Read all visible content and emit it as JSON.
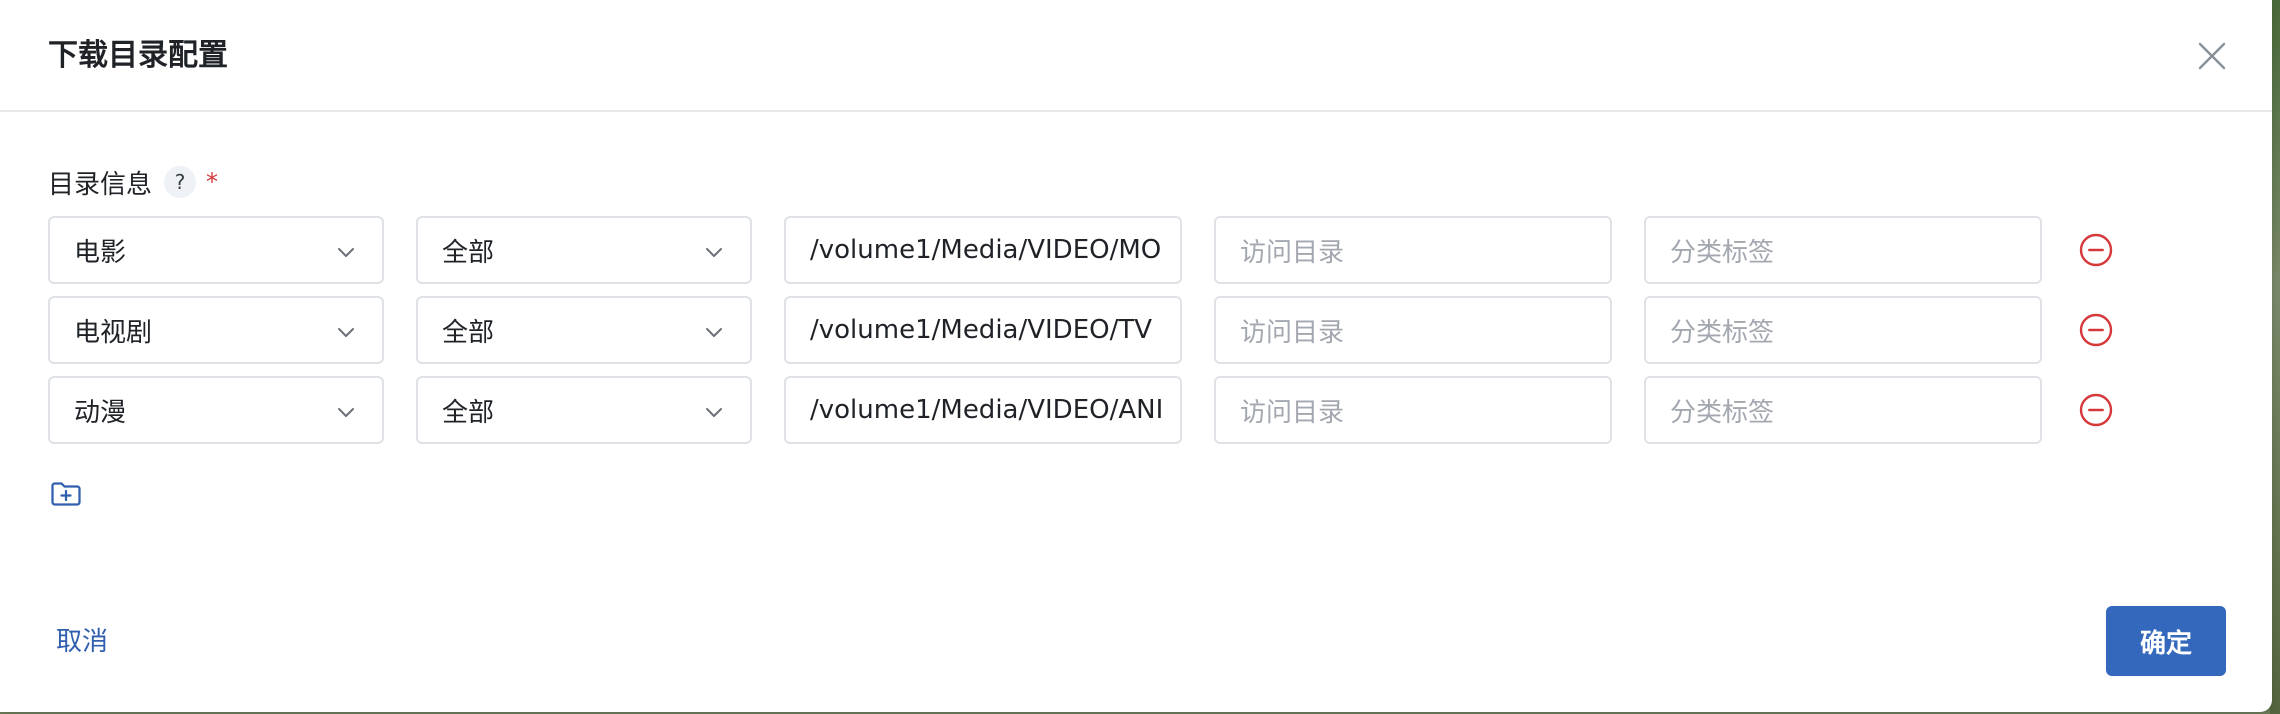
{
  "dialog": {
    "title": "下载目录配置",
    "cancel_label": "取消",
    "confirm_label": "确定"
  },
  "field": {
    "label": "目录信息",
    "help": "?",
    "required": "*"
  },
  "rows": [
    {
      "media_type": "电影",
      "scope": "全部",
      "download_path": "/volume1/Media/VIDEO/MO",
      "access_placeholder": "访问目录",
      "tag_placeholder": "分类标签"
    },
    {
      "media_type": "电视剧",
      "scope": "全部",
      "download_path": "/volume1/Media/VIDEO/TV",
      "access_placeholder": "访问目录",
      "tag_placeholder": "分类标签"
    },
    {
      "media_type": "动漫",
      "scope": "全部",
      "download_path": "/volume1/Media/VIDEO/ANI",
      "access_placeholder": "访问目录",
      "tag_placeholder": "分类标签"
    }
  ],
  "colors": {
    "primary": "#3468bd",
    "danger": "#d63939",
    "border": "#dfe2e6"
  },
  "icons": {
    "close": "close-icon",
    "chevron": "chevron-down-icon",
    "remove": "minus-circle-icon",
    "add": "folder-plus-icon"
  }
}
